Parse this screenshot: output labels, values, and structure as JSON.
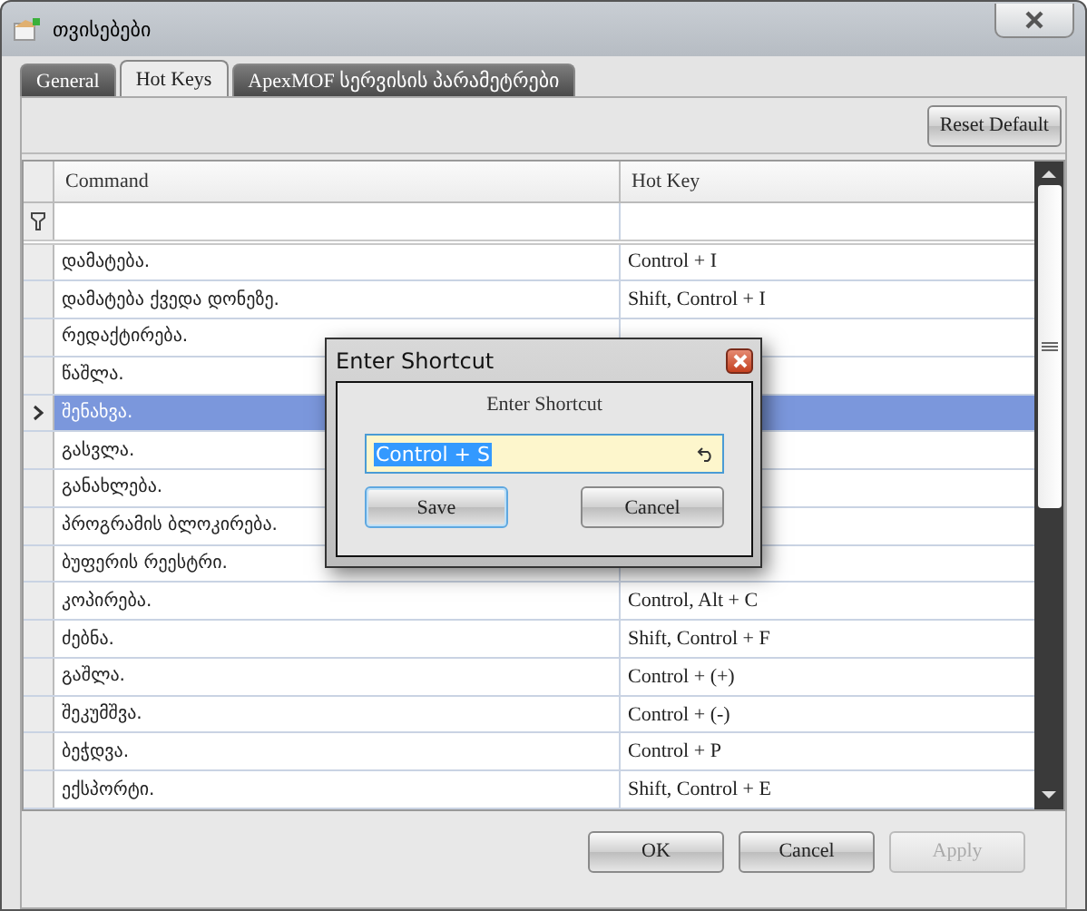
{
  "window": {
    "title": "თვისებები"
  },
  "tabs": [
    {
      "label": "General",
      "selected": false
    },
    {
      "label": "Hot Keys",
      "selected": true
    },
    {
      "label": "ApexMOF სერვისის პარამეტრები",
      "selected": false
    }
  ],
  "toolbar": {
    "reset_button": "Reset Default"
  },
  "table": {
    "columns": [
      "Command",
      "Hot Key"
    ],
    "rows": [
      {
        "command": "დამატება.",
        "hot_key": "Control + I",
        "selected": false
      },
      {
        "command": "დამატება ქვედა დონეზე.",
        "hot_key": "Shift, Control + I",
        "selected": false
      },
      {
        "command": "რედაქტირება.",
        "selected": false
      },
      {
        "command": "წაშლა.",
        "selected": false
      },
      {
        "command": "შენახვა.",
        "selected": true
      },
      {
        "command": "გასვლა.",
        "selected": false
      },
      {
        "command": "განახლება.",
        "selected": false
      },
      {
        "command": "პროგრამის ბლოკირება.",
        "selected": false
      },
      {
        "command": "ბუფერის რეესტრი.",
        "selected": false
      },
      {
        "command": "კოპირება.",
        "hot_key": "Control, Alt + C",
        "selected": false
      },
      {
        "command": "ძებნა.",
        "hot_key": "Shift, Control + F",
        "selected": false
      },
      {
        "command": "გაშლა.",
        "hot_key": "Control + (+)",
        "selected": false
      },
      {
        "command": "შეკუმშვა.",
        "hot_key": "Control + (-)",
        "selected": false
      },
      {
        "command": "ბეჭდვა.",
        "hot_key": "Control + P",
        "selected": false
      },
      {
        "command": "ექსპორტი.",
        "hot_key": "Shift, Control + E",
        "selected": false
      }
    ]
  },
  "buttons": [
    {
      "label": "OK",
      "disabled": false
    },
    {
      "label": "Cancel",
      "disabled": false
    },
    {
      "label": "Apply",
      "disabled": true
    }
  ],
  "dialog": {
    "title": "Enter Shortcut",
    "prompt": "Enter Shortcut",
    "field": {
      "value": "Control + S"
    },
    "buttons": [
      {
        "label": "Save",
        "focused": true
      },
      {
        "label": "Cancel",
        "focused": false
      }
    ]
  }
}
